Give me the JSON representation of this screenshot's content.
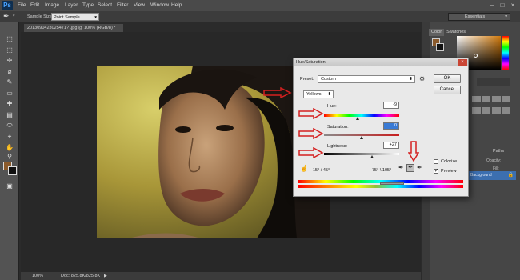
{
  "app": {
    "logo": "Ps"
  },
  "menu": [
    "File",
    "Edit",
    "Image",
    "Layer",
    "Type",
    "Select",
    "Filter",
    "View",
    "Window",
    "Help"
  ],
  "window_buttons": [
    "–",
    "□",
    "×"
  ],
  "options_bar": {
    "sample_size_label": "Sample Size:",
    "sample_size_value": "Point Sample"
  },
  "workspace": "Essentials",
  "document": {
    "tab_title": "2013090423025471? .jpg @ 100% (RGB/8) *",
    "zoom": "100%",
    "doc_info": "Doc: 825.8K/825.8K"
  },
  "panels": {
    "color_tab": "Color",
    "swatches_tab": "Swatches",
    "paths_label": "Paths",
    "opacity_label": "Opacity:",
    "fill_label": "Fill:",
    "layer_name": "Background"
  },
  "tools": [
    "⬚",
    "⬚",
    "✢",
    "⌀",
    "✎",
    "▭",
    "✚",
    "▤",
    "⬭",
    "⌖",
    "✏",
    "◐",
    "A",
    "↖",
    "☐",
    "✋",
    "⚲"
  ],
  "dialog": {
    "title": "Hue/Saturation",
    "close": "×",
    "preset_label": "Preset:",
    "preset_value": "Custom",
    "ok": "OK",
    "cancel": "Cancel",
    "channel": "Yellows",
    "hue_label": "Hue:",
    "hue_value": "-9",
    "saturation_label": "Saturation:",
    "saturation_value": "0",
    "lightness_label": "Lightness:",
    "lightness_value": "+27",
    "range_left": "15° / 45°",
    "range_right": "75° \\ 105°",
    "colorize": "Colorize",
    "preview": "Preview",
    "preview_checked": "✓"
  },
  "sliders": {
    "hue_fraction": 0.45,
    "saturation_fraction": 0.5,
    "lightness_fraction": 0.64
  },
  "colors": {
    "arrow_red": "#d42020",
    "accent_blue": "#3a7bd5",
    "app_bg": "#2b2b2b"
  }
}
